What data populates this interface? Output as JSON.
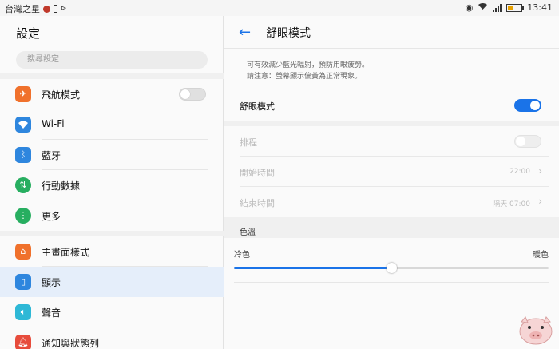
{
  "status_bar": {
    "carrier": "台灣之星",
    "time": "13:41"
  },
  "left": {
    "title": "設定",
    "search_placeholder": "搜尋設定",
    "items": [
      {
        "label": "飛航模式",
        "icon": "airplane-icon",
        "color": "#f0712c"
      },
      {
        "label": "Wi-Fi",
        "icon": "wifi-icon",
        "color": "#2e86de"
      },
      {
        "label": "藍牙",
        "icon": "bluetooth-icon",
        "color": "#2e86de"
      },
      {
        "label": "行動數據",
        "icon": "mobile-data-icon",
        "color": "#27ae60"
      },
      {
        "label": "更多",
        "icon": "more-icon",
        "color": "#27ae60"
      },
      {
        "label": "主畫面樣式",
        "icon": "home-icon",
        "color": "#f0712c"
      },
      {
        "label": "顯示",
        "icon": "display-icon",
        "color": "#2e86de"
      },
      {
        "label": "聲音",
        "icon": "sound-icon",
        "color": "#2eb8d6"
      },
      {
        "label": "通知與狀態列",
        "icon": "notification-icon",
        "color": "#e74c3c"
      }
    ]
  },
  "right": {
    "title": "舒眼模式",
    "description_line1": "可有效減少藍光輻射，預防用眼疲勞。",
    "description_line2": "請注意：螢幕顯示偏黃為正常現象。",
    "eye_comfort_label": "舒眼模式",
    "schedule_label": "排程",
    "start_time_label": "開始時間",
    "start_time_value": "22:00",
    "end_time_label": "結束時間",
    "end_time_value": "隔天 07:00",
    "color_temp_label": "色溫",
    "cool_label": "冷色",
    "warm_label": "暖色",
    "color_temp_level": 0.5
  },
  "accent_color": "#1a73e8"
}
